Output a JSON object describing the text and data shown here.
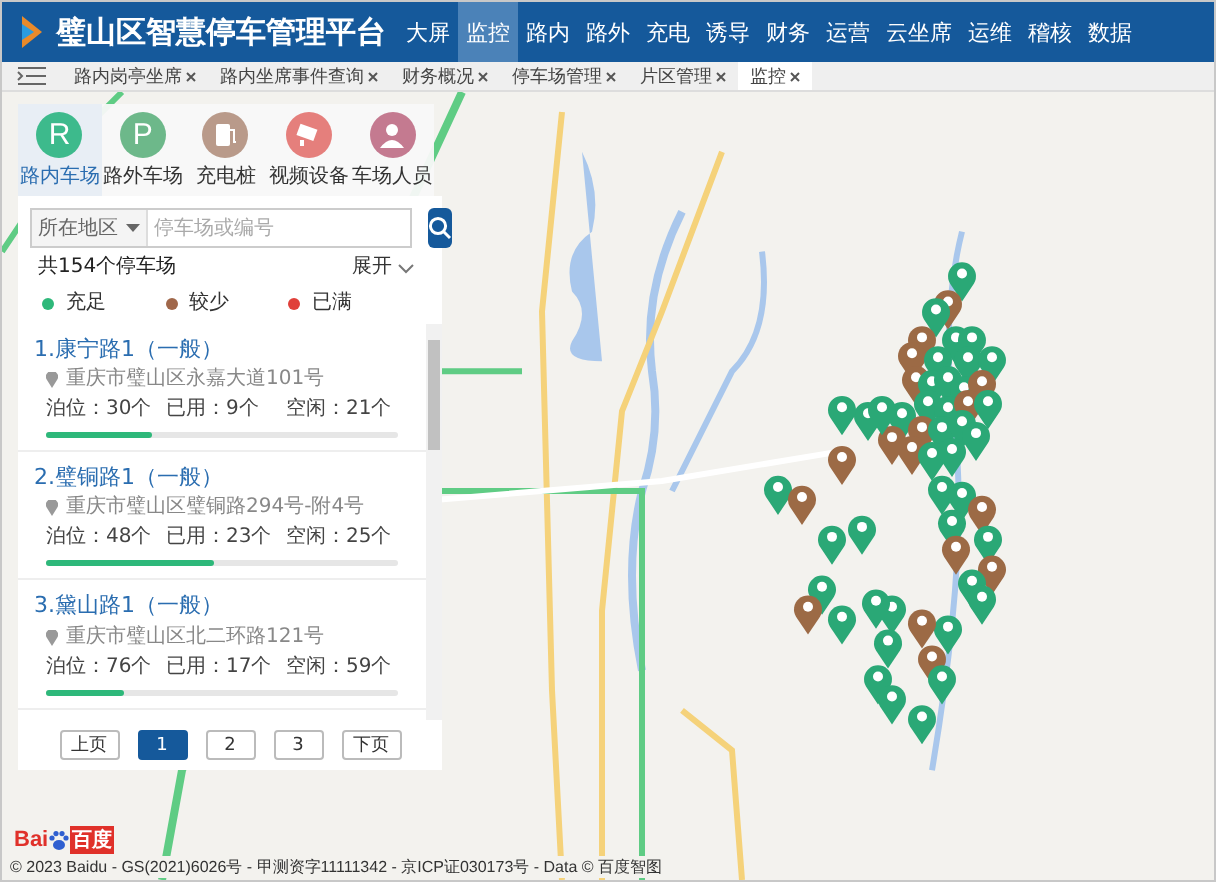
{
  "header": {
    "title": "璧山区智慧停车管理平台",
    "nav": [
      {
        "label": "大屏",
        "selected": false
      },
      {
        "label": "监控",
        "selected": true
      },
      {
        "label": "路内",
        "selected": false
      },
      {
        "label": "路外",
        "selected": false
      },
      {
        "label": "充电",
        "selected": false
      },
      {
        "label": "诱导",
        "selected": false
      },
      {
        "label": "财务",
        "selected": false
      },
      {
        "label": "运营",
        "selected": false
      },
      {
        "label": "云坐席",
        "selected": false
      },
      {
        "label": "运维",
        "selected": false
      },
      {
        "label": "稽核",
        "selected": false
      },
      {
        "label": "数据",
        "selected": false
      }
    ]
  },
  "tabs": [
    {
      "label": "路内岗亭坐席",
      "selected": false
    },
    {
      "label": "路内坐席事件查询",
      "selected": false
    },
    {
      "label": "财务概况",
      "selected": false
    },
    {
      "label": "停车场管理",
      "selected": false
    },
    {
      "label": "片区管理",
      "selected": false
    },
    {
      "label": "监控",
      "selected": true
    }
  ],
  "categories": [
    {
      "label": "路内车场",
      "selected": true,
      "color": "#3dba8c",
      "kind": "letter",
      "letter": "R"
    },
    {
      "label": "路外车场",
      "selected": false,
      "color": "#6db88a",
      "kind": "letter",
      "letter": "P"
    },
    {
      "label": "充电桩",
      "selected": false,
      "color": "#b99a8a",
      "kind": "charger"
    },
    {
      "label": "视频设备",
      "selected": false,
      "color": "#e57f7c",
      "kind": "camera"
    },
    {
      "label": "车场人员",
      "selected": false,
      "color": "#c47a90",
      "kind": "person"
    }
  ],
  "search": {
    "region": "所在地区",
    "placeholder": "停车场或编号"
  },
  "summary": {
    "count": "共154个停车场",
    "expand": "展开"
  },
  "legend": [
    {
      "label": "充足",
      "color": "#2eb87a"
    },
    {
      "label": "较少",
      "color": "#a0674a"
    },
    {
      "label": "已满",
      "color": "#e0403a"
    }
  ],
  "lots": [
    {
      "title": "1.康宁路1（一般）",
      "address": "重庆市璧山区永嘉大道101号",
      "capacity": "泊位：30个",
      "used": "已用：9个",
      "free": "空闲：21个",
      "level": 0.3
    },
    {
      "title": "2.璧铜路1（一般）",
      "address": "重庆市璧山区璧铜路294号-附4号",
      "capacity": "泊位：48个",
      "used": "已用：23个",
      "free": "空闲：25个",
      "level": 0.48
    },
    {
      "title": "3.黛山路1（一般）",
      "address": "重庆市璧山区北二环路121号",
      "capacity": "泊位：76个",
      "used": "已用：17个",
      "free": "空闲：59个",
      "level": 0.22
    }
  ],
  "pagination": {
    "prev": "上页",
    "pages": [
      {
        "label": "1",
        "selected": true
      },
      {
        "label": "2",
        "selected": false
      },
      {
        "label": "3",
        "selected": false
      }
    ],
    "next": "下页"
  },
  "map": {
    "logo_latin": "Bai",
    "logo_cjk": "百度",
    "copyright": "© 2023 Baidu - GS(2021)6026号 - 甲测资字11111342 - 京ICP证030173号 - Data © 百度智图"
  }
}
